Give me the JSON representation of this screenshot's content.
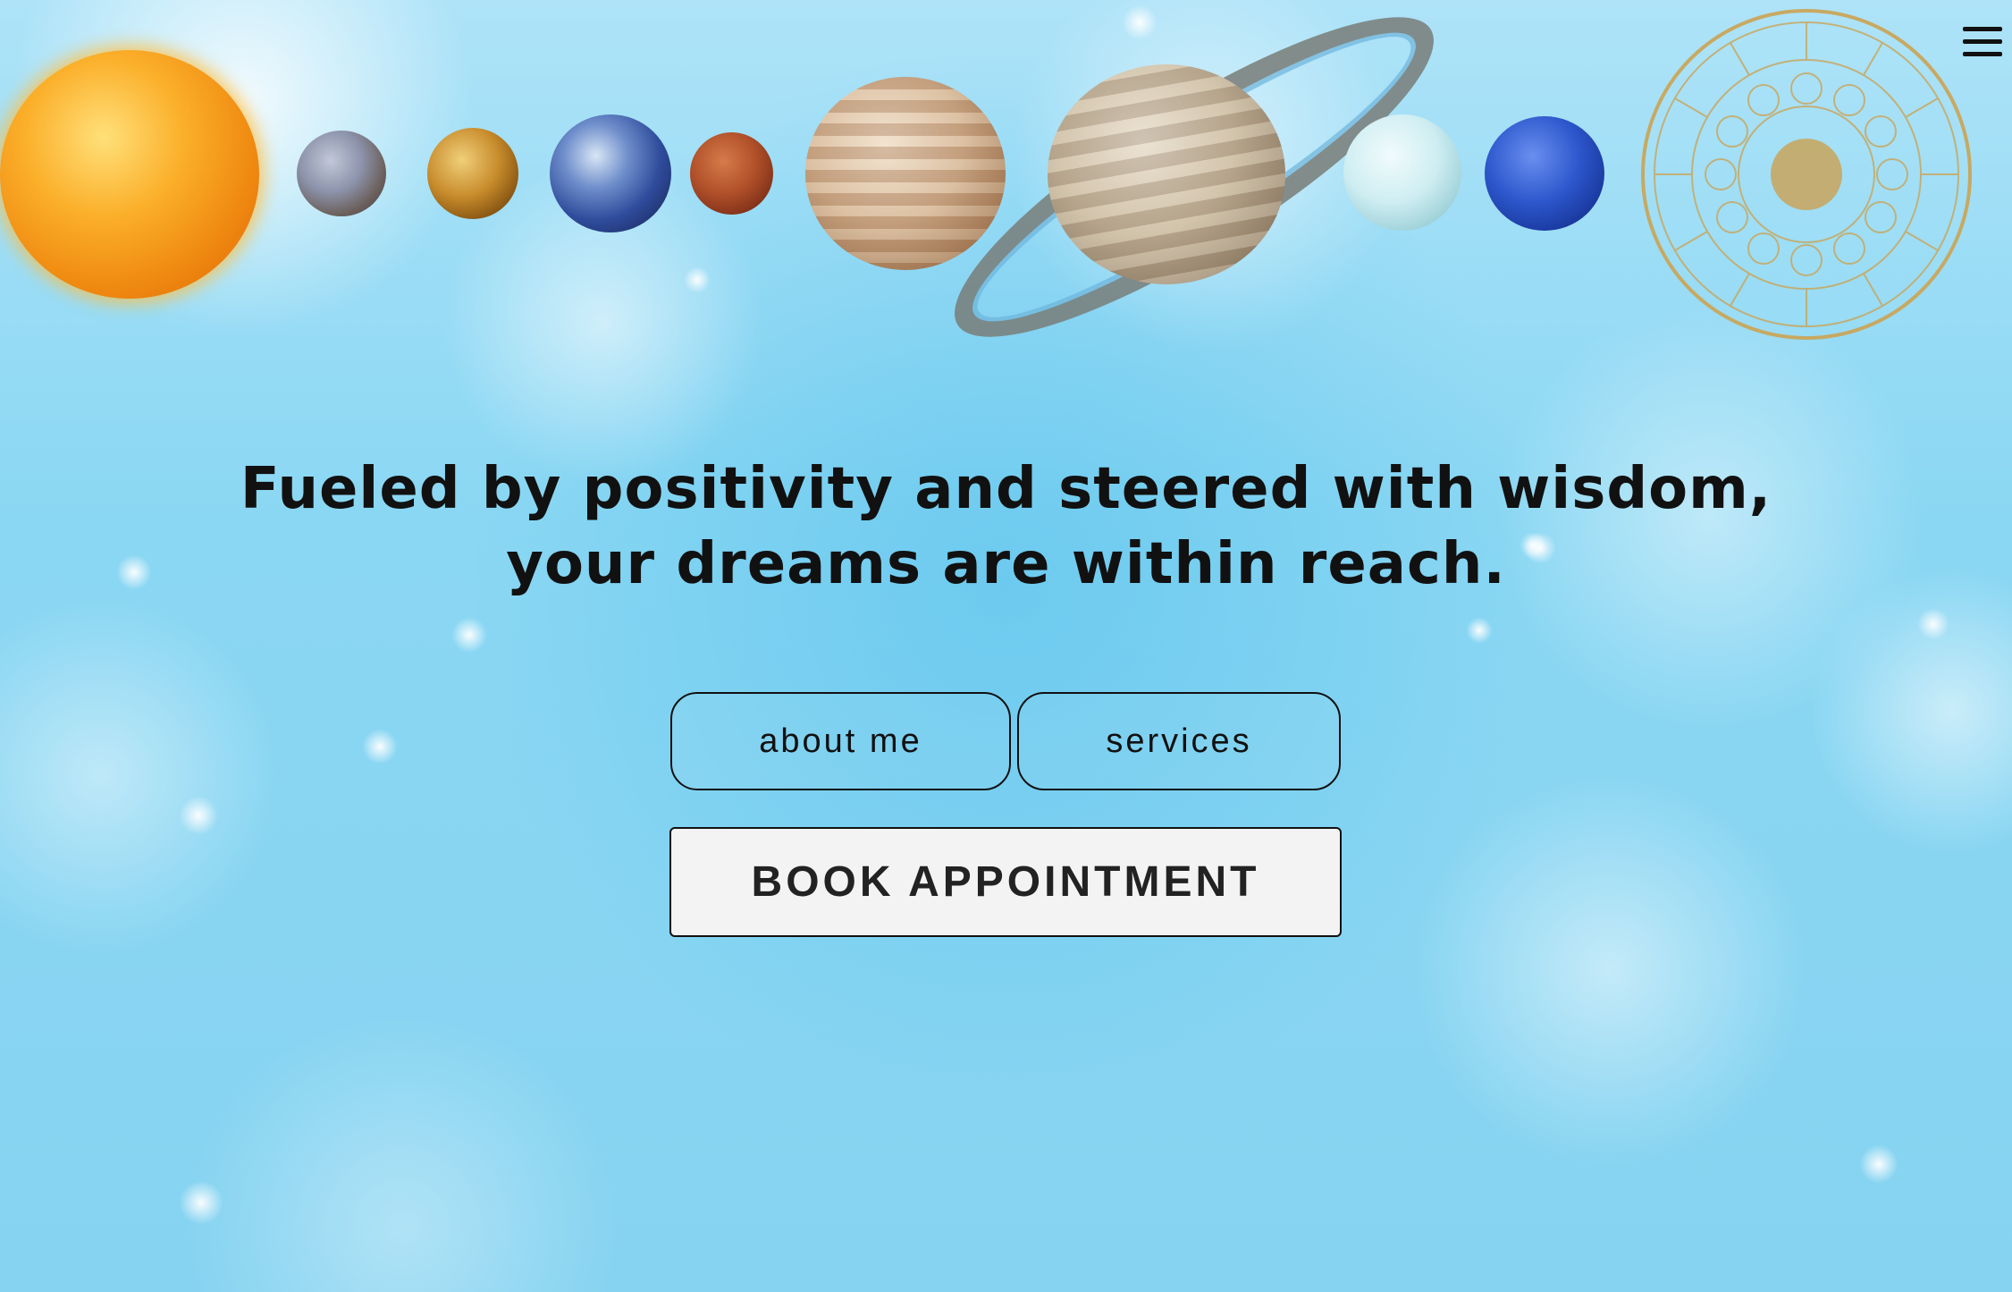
{
  "header": {
    "planets": [
      "sun-icon",
      "mercury-icon",
      "venus-icon",
      "earth-icon",
      "mars-icon",
      "jupiter-icon",
      "saturn-icon",
      "uranus-icon",
      "neptune-icon"
    ],
    "zodiac_icon": "zodiac-wheel-icon",
    "menu_icon": "hamburger-menu-icon"
  },
  "hero": {
    "tagline_line1": "Fueled by positivity and steered with wisdom,",
    "tagline_line2": "your dreams are within reach."
  },
  "nav": {
    "about_label": "about me",
    "services_label": "services",
    "book_label": "BOOK APPOINTMENT"
  },
  "colors": {
    "background": "#8ad7f3",
    "text": "#111111",
    "button_fill": "#f3f3f3",
    "zodiac_gold": "#c9a55a"
  }
}
